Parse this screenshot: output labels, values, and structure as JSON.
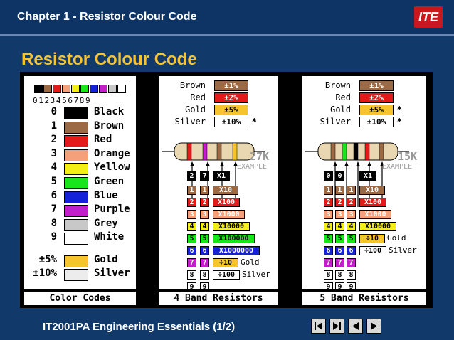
{
  "header": {
    "title": "Chapter 1 -  Resistor Colour Code",
    "logo_text": "ITE"
  },
  "page_title": "Resistor Colour Code",
  "color_codes": {
    "digits": "0123456789",
    "rows": [
      {
        "num": "0",
        "name": "Black",
        "color": "#000000"
      },
      {
        "num": "1",
        "name": "Brown",
        "color": "#9b6a44"
      },
      {
        "num": "2",
        "name": "Red",
        "color": "#e21a1a"
      },
      {
        "num": "3",
        "name": "Orange",
        "color": "#f4a07a"
      },
      {
        "num": "4",
        "name": "Yellow",
        "color": "#f3ef16"
      },
      {
        "num": "5",
        "name": "Green",
        "color": "#19e61a"
      },
      {
        "num": "6",
        "name": "Blue",
        "color": "#1421d8"
      },
      {
        "num": "7",
        "name": "Purple",
        "color": "#c21fc9"
      },
      {
        "num": "8",
        "name": "Grey",
        "color": "#c8c8c8"
      },
      {
        "num": "9",
        "name": "White",
        "color": "#ffffff"
      }
    ],
    "tolerance_rows": [
      {
        "num": "±5%",
        "name": "Gold",
        "color": "#f6c52e"
      },
      {
        "num": "±10%",
        "name": "Silver",
        "color": "#ececec"
      }
    ],
    "footer": "Color Codes"
  },
  "four_band": {
    "tolerances": [
      {
        "label": "Brown",
        "value": "±1%",
        "color": "#9b6a44"
      },
      {
        "label": "Red",
        "value": "±2%",
        "color": "#e21a1a"
      },
      {
        "label": "Gold",
        "value": "±5%",
        "color": "#f6c52e"
      },
      {
        "label": "Silver",
        "value": "±10%",
        "color": "#ffffff",
        "star": "*"
      }
    ],
    "example_value": "27K",
    "example_label": "EXAMPLE",
    "example_digits": [
      "2",
      "7",
      "X1"
    ],
    "rows": [
      {
        "d": "1",
        "m": "X10",
        "color": "#9b6a44",
        "dark": false
      },
      {
        "d": "2",
        "m": "X100",
        "color": "#e21a1a",
        "dark": false
      },
      {
        "d": "3",
        "m": "X1000",
        "color": "#f4a07a",
        "dark": false
      },
      {
        "d": "4",
        "m": "X10000",
        "color": "#f3ef16",
        "dark": true
      },
      {
        "d": "5",
        "m": "X100000",
        "color": "#19e61a",
        "dark": true
      },
      {
        "d": "6",
        "m": "X1000000",
        "color": "#1421d8",
        "dark": false
      },
      {
        "d": "7",
        "m": "÷10",
        "color": "#c21fc9",
        "mcolor": "#f6c52e",
        "mlabel": "Gold",
        "dark": false
      },
      {
        "d": "8",
        "m": "÷100",
        "color": "#ffffff",
        "mcolor": "#ffffff",
        "mlabel": "Silver",
        "dark": true
      },
      {
        "d": "9",
        "m": "",
        "color": "#ffffff",
        "dark": true
      }
    ],
    "footer": "4 Band Resistors"
  },
  "five_band": {
    "tolerances": [
      {
        "label": "Brown",
        "value": "±1%",
        "color": "#9b6a44"
      },
      {
        "label": "Red",
        "value": "±2%",
        "color": "#e21a1a"
      },
      {
        "label": "Gold",
        "value": "±5%",
        "color": "#f6c52e",
        "star": "*"
      },
      {
        "label": "Silver",
        "value": "±10%",
        "color": "#ffffff",
        "star": "*"
      }
    ],
    "example_value": "15K",
    "example_label": "EXAMPLE",
    "example_digits": [
      "0",
      "0",
      "X1"
    ],
    "rows": [
      {
        "d": "1",
        "m": "X10",
        "color": "#9b6a44",
        "dark": false
      },
      {
        "d": "2",
        "m": "X100",
        "color": "#e21a1a",
        "dark": false
      },
      {
        "d": "3",
        "m": "X1000",
        "color": "#f4a07a",
        "dark": false
      },
      {
        "d": "4",
        "m": "X10000",
        "color": "#f3ef16",
        "dark": true
      },
      {
        "d": "5",
        "m": "÷10",
        "color": "#19e61a",
        "mcolor": "#f6c52e",
        "mlabel": "Gold",
        "dark": true
      },
      {
        "d": "6",
        "m": "÷100",
        "color": "#1421d8",
        "mcolor": "#ffffff",
        "mlabel": "Silver",
        "dark": false
      },
      {
        "d": "7",
        "m": "",
        "color": "#c21fc9",
        "dark": false
      },
      {
        "d": "8",
        "m": "",
        "color": "#ffffff",
        "dark": true
      },
      {
        "d": "9",
        "m": "",
        "color": "#ffffff",
        "dark": true
      }
    ],
    "footer": "5 Band Resistors"
  },
  "footer": {
    "text": "IT2001PA Engineering Essentials (1/2)"
  }
}
